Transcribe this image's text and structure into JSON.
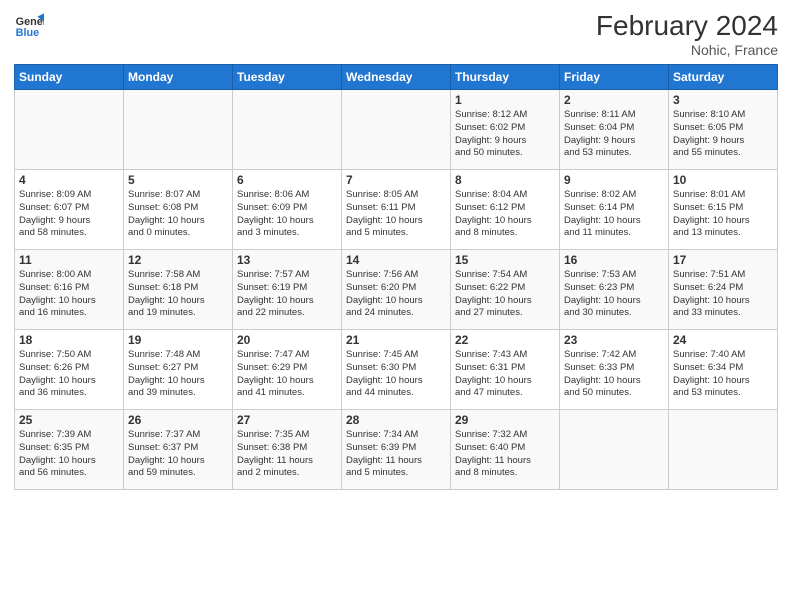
{
  "header": {
    "logo_line1": "General",
    "logo_line2": "Blue",
    "month_title": "February 2024",
    "location": "Nohic, France"
  },
  "days_of_week": [
    "Sunday",
    "Monday",
    "Tuesday",
    "Wednesday",
    "Thursday",
    "Friday",
    "Saturday"
  ],
  "weeks": [
    [
      {
        "day": "",
        "info": ""
      },
      {
        "day": "",
        "info": ""
      },
      {
        "day": "",
        "info": ""
      },
      {
        "day": "",
        "info": ""
      },
      {
        "day": "1",
        "info": "Sunrise: 8:12 AM\nSunset: 6:02 PM\nDaylight: 9 hours\nand 50 minutes."
      },
      {
        "day": "2",
        "info": "Sunrise: 8:11 AM\nSunset: 6:04 PM\nDaylight: 9 hours\nand 53 minutes."
      },
      {
        "day": "3",
        "info": "Sunrise: 8:10 AM\nSunset: 6:05 PM\nDaylight: 9 hours\nand 55 minutes."
      }
    ],
    [
      {
        "day": "4",
        "info": "Sunrise: 8:09 AM\nSunset: 6:07 PM\nDaylight: 9 hours\nand 58 minutes."
      },
      {
        "day": "5",
        "info": "Sunrise: 8:07 AM\nSunset: 6:08 PM\nDaylight: 10 hours\nand 0 minutes."
      },
      {
        "day": "6",
        "info": "Sunrise: 8:06 AM\nSunset: 6:09 PM\nDaylight: 10 hours\nand 3 minutes."
      },
      {
        "day": "7",
        "info": "Sunrise: 8:05 AM\nSunset: 6:11 PM\nDaylight: 10 hours\nand 5 minutes."
      },
      {
        "day": "8",
        "info": "Sunrise: 8:04 AM\nSunset: 6:12 PM\nDaylight: 10 hours\nand 8 minutes."
      },
      {
        "day": "9",
        "info": "Sunrise: 8:02 AM\nSunset: 6:14 PM\nDaylight: 10 hours\nand 11 minutes."
      },
      {
        "day": "10",
        "info": "Sunrise: 8:01 AM\nSunset: 6:15 PM\nDaylight: 10 hours\nand 13 minutes."
      }
    ],
    [
      {
        "day": "11",
        "info": "Sunrise: 8:00 AM\nSunset: 6:16 PM\nDaylight: 10 hours\nand 16 minutes."
      },
      {
        "day": "12",
        "info": "Sunrise: 7:58 AM\nSunset: 6:18 PM\nDaylight: 10 hours\nand 19 minutes."
      },
      {
        "day": "13",
        "info": "Sunrise: 7:57 AM\nSunset: 6:19 PM\nDaylight: 10 hours\nand 22 minutes."
      },
      {
        "day": "14",
        "info": "Sunrise: 7:56 AM\nSunset: 6:20 PM\nDaylight: 10 hours\nand 24 minutes."
      },
      {
        "day": "15",
        "info": "Sunrise: 7:54 AM\nSunset: 6:22 PM\nDaylight: 10 hours\nand 27 minutes."
      },
      {
        "day": "16",
        "info": "Sunrise: 7:53 AM\nSunset: 6:23 PM\nDaylight: 10 hours\nand 30 minutes."
      },
      {
        "day": "17",
        "info": "Sunrise: 7:51 AM\nSunset: 6:24 PM\nDaylight: 10 hours\nand 33 minutes."
      }
    ],
    [
      {
        "day": "18",
        "info": "Sunrise: 7:50 AM\nSunset: 6:26 PM\nDaylight: 10 hours\nand 36 minutes."
      },
      {
        "day": "19",
        "info": "Sunrise: 7:48 AM\nSunset: 6:27 PM\nDaylight: 10 hours\nand 39 minutes."
      },
      {
        "day": "20",
        "info": "Sunrise: 7:47 AM\nSunset: 6:29 PM\nDaylight: 10 hours\nand 41 minutes."
      },
      {
        "day": "21",
        "info": "Sunrise: 7:45 AM\nSunset: 6:30 PM\nDaylight: 10 hours\nand 44 minutes."
      },
      {
        "day": "22",
        "info": "Sunrise: 7:43 AM\nSunset: 6:31 PM\nDaylight: 10 hours\nand 47 minutes."
      },
      {
        "day": "23",
        "info": "Sunrise: 7:42 AM\nSunset: 6:33 PM\nDaylight: 10 hours\nand 50 minutes."
      },
      {
        "day": "24",
        "info": "Sunrise: 7:40 AM\nSunset: 6:34 PM\nDaylight: 10 hours\nand 53 minutes."
      }
    ],
    [
      {
        "day": "25",
        "info": "Sunrise: 7:39 AM\nSunset: 6:35 PM\nDaylight: 10 hours\nand 56 minutes."
      },
      {
        "day": "26",
        "info": "Sunrise: 7:37 AM\nSunset: 6:37 PM\nDaylight: 10 hours\nand 59 minutes."
      },
      {
        "day": "27",
        "info": "Sunrise: 7:35 AM\nSunset: 6:38 PM\nDaylight: 11 hours\nand 2 minutes."
      },
      {
        "day": "28",
        "info": "Sunrise: 7:34 AM\nSunset: 6:39 PM\nDaylight: 11 hours\nand 5 minutes."
      },
      {
        "day": "29",
        "info": "Sunrise: 7:32 AM\nSunset: 6:40 PM\nDaylight: 11 hours\nand 8 minutes."
      },
      {
        "day": "",
        "info": ""
      },
      {
        "day": "",
        "info": ""
      }
    ]
  ]
}
